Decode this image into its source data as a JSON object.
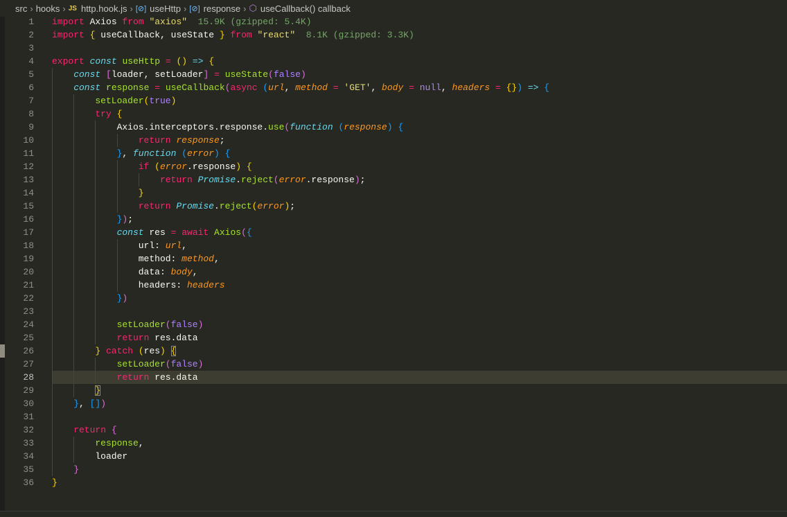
{
  "breadcrumb": {
    "items": [
      "src",
      "hooks",
      "http.hook.js",
      "useHttp",
      "response",
      "useCallback() callback"
    ],
    "js_badge": "JS"
  },
  "editor": {
    "current_line": 28,
    "lines": [
      [
        [
          "kw",
          "import"
        ],
        [
          "pl",
          " Axios "
        ],
        [
          "kw",
          "from"
        ],
        [
          "pl",
          " "
        ],
        [
          "str",
          "\"axios\""
        ],
        [
          "hint",
          "  15.9K (gzipped: 5.4K)"
        ]
      ],
      [
        [
          "kw",
          "import"
        ],
        [
          "pl",
          " "
        ],
        [
          "b1",
          "{"
        ],
        [
          "pl",
          " useCallback, useState "
        ],
        [
          "b1",
          "}"
        ],
        [
          "pl",
          " "
        ],
        [
          "kw",
          "from"
        ],
        [
          "pl",
          " "
        ],
        [
          "str",
          "\"react\""
        ],
        [
          "hint",
          "  8.1K (gzipped: 3.3K)"
        ]
      ],
      [],
      [
        [
          "kw",
          "export"
        ],
        [
          "pl",
          " "
        ],
        [
          "st",
          "const"
        ],
        [
          "pl",
          " "
        ],
        [
          "fn",
          "useHttp"
        ],
        [
          "pl",
          " "
        ],
        [
          "kw",
          "="
        ],
        [
          "pl",
          " "
        ],
        [
          "b1",
          "()"
        ],
        [
          "pl",
          " "
        ],
        [
          "st",
          "=>"
        ],
        [
          "pl",
          " "
        ],
        [
          "b1",
          "{"
        ]
      ],
      [
        [
          "pl",
          "    "
        ],
        [
          "st",
          "const"
        ],
        [
          "pl",
          " "
        ],
        [
          "b2",
          "["
        ],
        [
          "pl",
          "loader, setLoader"
        ],
        [
          "b2",
          "]"
        ],
        [
          "pl",
          " "
        ],
        [
          "kw",
          "="
        ],
        [
          "pl",
          " "
        ],
        [
          "fn",
          "useState"
        ],
        [
          "b2",
          "("
        ],
        [
          "num",
          "false"
        ],
        [
          "b2",
          ")"
        ]
      ],
      [
        [
          "pl",
          "    "
        ],
        [
          "st",
          "const"
        ],
        [
          "pl",
          " "
        ],
        [
          "fn",
          "response"
        ],
        [
          "pl",
          " "
        ],
        [
          "kw",
          "="
        ],
        [
          "pl",
          " "
        ],
        [
          "fn",
          "useCallback"
        ],
        [
          "b2",
          "("
        ],
        [
          "kw",
          "async"
        ],
        [
          "pl",
          " "
        ],
        [
          "b3",
          "("
        ],
        [
          "par",
          "url"
        ],
        [
          "pl",
          ", "
        ],
        [
          "par",
          "method"
        ],
        [
          "pl",
          " "
        ],
        [
          "kw",
          "="
        ],
        [
          "pl",
          " "
        ],
        [
          "str",
          "'GET'"
        ],
        [
          "pl",
          ", "
        ],
        [
          "par",
          "body"
        ],
        [
          "pl",
          " "
        ],
        [
          "kw",
          "="
        ],
        [
          "pl",
          " "
        ],
        [
          "num",
          "null"
        ],
        [
          "pl",
          ", "
        ],
        [
          "par",
          "headers"
        ],
        [
          "pl",
          " "
        ],
        [
          "kw",
          "="
        ],
        [
          "pl",
          " "
        ],
        [
          "b1",
          "{}"
        ],
        [
          "b3",
          ")"
        ],
        [
          "pl",
          " "
        ],
        [
          "st",
          "=>"
        ],
        [
          "pl",
          " "
        ],
        [
          "b3",
          "{"
        ]
      ],
      [
        [
          "pl",
          "        "
        ],
        [
          "fn",
          "setLoader"
        ],
        [
          "b1",
          "("
        ],
        [
          "num",
          "true"
        ],
        [
          "b1",
          ")"
        ]
      ],
      [
        [
          "pl",
          "        "
        ],
        [
          "kw",
          "try"
        ],
        [
          "pl",
          " "
        ],
        [
          "b1",
          "{"
        ]
      ],
      [
        [
          "pl",
          "            Axios.interceptors.response."
        ],
        [
          "fn",
          "use"
        ],
        [
          "b2",
          "("
        ],
        [
          "st",
          "function"
        ],
        [
          "pl",
          " "
        ],
        [
          "b3",
          "("
        ],
        [
          "par",
          "response"
        ],
        [
          "b3",
          ")"
        ],
        [
          "pl",
          " "
        ],
        [
          "b3",
          "{"
        ]
      ],
      [
        [
          "pl",
          "                "
        ],
        [
          "kw",
          "return"
        ],
        [
          "pl",
          " "
        ],
        [
          "par",
          "response"
        ],
        [
          "pl",
          ";"
        ]
      ],
      [
        [
          "pl",
          "            "
        ],
        [
          "b3",
          "}"
        ],
        [
          "pl",
          ", "
        ],
        [
          "st",
          "function"
        ],
        [
          "pl",
          " "
        ],
        [
          "b3",
          "("
        ],
        [
          "par",
          "error"
        ],
        [
          "b3",
          ")"
        ],
        [
          "pl",
          " "
        ],
        [
          "b3",
          "{"
        ]
      ],
      [
        [
          "pl",
          "                "
        ],
        [
          "kw",
          "if"
        ],
        [
          "pl",
          " "
        ],
        [
          "b1",
          "("
        ],
        [
          "par",
          "error"
        ],
        [
          "pl",
          ".response"
        ],
        [
          "b1",
          ")"
        ],
        [
          "pl",
          " "
        ],
        [
          "b1",
          "{"
        ]
      ],
      [
        [
          "pl",
          "                    "
        ],
        [
          "kw",
          "return"
        ],
        [
          "pl",
          " "
        ],
        [
          "st",
          "Promise"
        ],
        [
          "pl",
          "."
        ],
        [
          "fn",
          "reject"
        ],
        [
          "b2",
          "("
        ],
        [
          "par",
          "error"
        ],
        [
          "pl",
          ".response"
        ],
        [
          "b2",
          ")"
        ],
        [
          "pl",
          ";"
        ]
      ],
      [
        [
          "pl",
          "                "
        ],
        [
          "b1",
          "}"
        ]
      ],
      [
        [
          "pl",
          "                "
        ],
        [
          "kw",
          "return"
        ],
        [
          "pl",
          " "
        ],
        [
          "st",
          "Promise"
        ],
        [
          "pl",
          "."
        ],
        [
          "fn",
          "reject"
        ],
        [
          "b1",
          "("
        ],
        [
          "par",
          "error"
        ],
        [
          "b1",
          ")"
        ],
        [
          "pl",
          ";"
        ]
      ],
      [
        [
          "pl",
          "            "
        ],
        [
          "b3",
          "}"
        ],
        [
          "b2",
          ")"
        ],
        [
          "pl",
          ";"
        ]
      ],
      [
        [
          "pl",
          "            "
        ],
        [
          "st",
          "const"
        ],
        [
          "pl",
          " res "
        ],
        [
          "kw",
          "="
        ],
        [
          "pl",
          " "
        ],
        [
          "kw",
          "await"
        ],
        [
          "pl",
          " "
        ],
        [
          "fn",
          "Axios"
        ],
        [
          "b2",
          "("
        ],
        [
          "b3",
          "{"
        ]
      ],
      [
        [
          "pl",
          "                url: "
        ],
        [
          "par",
          "url"
        ],
        [
          "pl",
          ","
        ]
      ],
      [
        [
          "pl",
          "                method: "
        ],
        [
          "par",
          "method"
        ],
        [
          "pl",
          ","
        ]
      ],
      [
        [
          "pl",
          "                data: "
        ],
        [
          "par",
          "body"
        ],
        [
          "pl",
          ","
        ]
      ],
      [
        [
          "pl",
          "                headers: "
        ],
        [
          "par",
          "headers"
        ]
      ],
      [
        [
          "pl",
          "            "
        ],
        [
          "b3",
          "}"
        ],
        [
          "b2",
          ")"
        ]
      ],
      [],
      [
        [
          "pl",
          "            "
        ],
        [
          "fn",
          "setLoader"
        ],
        [
          "b2",
          "("
        ],
        [
          "num",
          "false"
        ],
        [
          "b2",
          ")"
        ]
      ],
      [
        [
          "pl",
          "            "
        ],
        [
          "kw",
          "return"
        ],
        [
          "pl",
          " res.data"
        ]
      ],
      [
        [
          "pl",
          "        "
        ],
        [
          "b1",
          "}"
        ],
        [
          "pl",
          " "
        ],
        [
          "kw",
          "catch"
        ],
        [
          "pl",
          " "
        ],
        [
          "b1",
          "("
        ],
        [
          "pl",
          "res"
        ],
        [
          "b1",
          ")"
        ],
        [
          "pl",
          " "
        ],
        [
          "b1 box",
          "{"
        ]
      ],
      [
        [
          "pl",
          "            "
        ],
        [
          "fn",
          "setLoader"
        ],
        [
          "b2",
          "("
        ],
        [
          "num",
          "false"
        ],
        [
          "b2",
          ")"
        ]
      ],
      [
        [
          "pl",
          "            "
        ],
        [
          "kw",
          "return"
        ],
        [
          "pl",
          " res.data"
        ]
      ],
      [
        [
          "pl",
          "        "
        ],
        [
          "b1 box",
          "}"
        ]
      ],
      [
        [
          "pl",
          "    "
        ],
        [
          "b3",
          "}"
        ],
        [
          "pl",
          ", "
        ],
        [
          "b3",
          "[]"
        ],
        [
          "b2",
          ")"
        ]
      ],
      [],
      [
        [
          "pl",
          "    "
        ],
        [
          "kw",
          "return"
        ],
        [
          "pl",
          " "
        ],
        [
          "b2",
          "{"
        ]
      ],
      [
        [
          "pl",
          "        "
        ],
        [
          "fn",
          "response"
        ],
        [
          "pl",
          ","
        ]
      ],
      [
        [
          "pl",
          "        loader"
        ]
      ],
      [
        [
          "pl",
          "    "
        ],
        [
          "b2",
          "}"
        ]
      ],
      [
        [
          "b1",
          "}"
        ]
      ]
    ]
  }
}
